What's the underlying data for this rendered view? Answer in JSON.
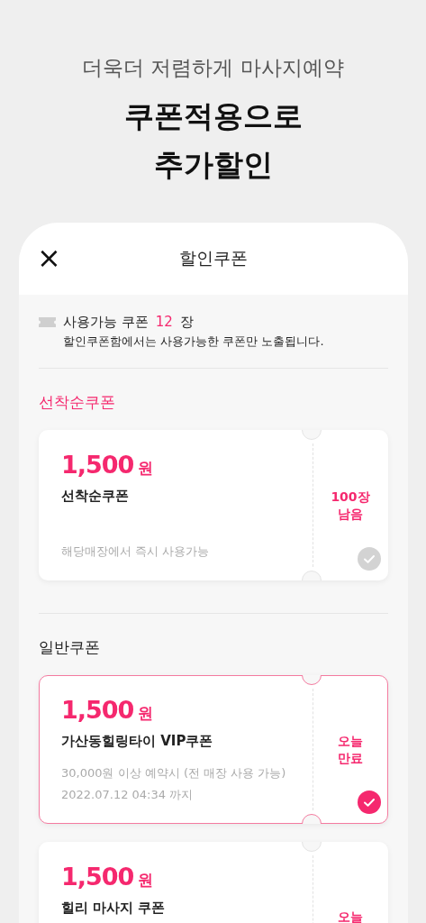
{
  "promo": {
    "subtitle": "더욱더 저렴하게 마사지예약",
    "headline": [
      "쿠폰적용으로",
      "추가할인"
    ]
  },
  "header": {
    "close": "×",
    "title": "할인쿠폰"
  },
  "summary": {
    "label": "사용가능 쿠폰",
    "count": "12",
    "unit": "장",
    "note": "할인쿠폰함에서는 사용가능한 쿠폰만 노출됩니다."
  },
  "sections": [
    {
      "title": "선착순쿠폰",
      "color": "#f5286e",
      "coupons": [
        {
          "amount": "1,500",
          "unit": "원",
          "name": "선착순쿠폰",
          "details": [
            "해당매장에서 즉시 사용가능"
          ],
          "status": [
            "100장",
            "남음"
          ],
          "selected": false
        }
      ]
    },
    {
      "title": "일반쿠폰",
      "color": "#222222",
      "coupons": [
        {
          "amount": "1,500",
          "unit": "원",
          "name": "가산동힐링타이 VIP쿠폰",
          "details": [
            "30,000원 이상 예약시 (전 매장 사용 가능)",
            "2022.07.12 04:34 까지"
          ],
          "status": [
            "오늘",
            "만료"
          ],
          "selected": true
        },
        {
          "amount": "1,500",
          "unit": "원",
          "name": "힐리 마사지 쿠폰",
          "status": [
            "오늘"
          ],
          "selected": false
        }
      ]
    }
  ]
}
